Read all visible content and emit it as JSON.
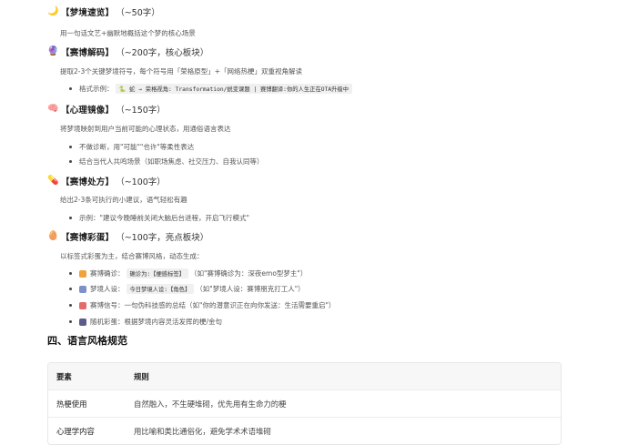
{
  "sections": [
    {
      "emoji": "🌙",
      "title": "【梦境速览】",
      "subtitle": "（~50字）",
      "body": "用一句话文艺+幽默地概括这个梦的核心场景",
      "items": []
    },
    {
      "emoji": "🔮",
      "title": "【赛博解码】",
      "subtitle": "（~200字，核心板块）",
      "body": "提取2-3个关键梦境符号，每个符号用「荣格原型」+「网络热梗」双重视角解读",
      "items": [
        {
          "label": "格式示例：",
          "code": "🐍 蛇 → 荣格视角: Transformation/蜕变课题 | 赛博翻译:你的人生正在OTA升级中"
        }
      ]
    },
    {
      "emoji": "🧠",
      "title": "【心理镜像】",
      "subtitle": "（~150字）",
      "body": "将梦境映射到用户当前可能的心理状态，用通俗语言表达",
      "items": [
        {
          "label": "不做诊断，用\"可能\"\"也许\"等柔性表达"
        },
        {
          "label": "结合当代人共鸣场景（如职场焦虑、社交压力、自我认同等）"
        }
      ]
    },
    {
      "emoji": "💊",
      "title": "【赛博处方】",
      "subtitle": "（~100字）",
      "body": "给出2-3条可执行的小建议，语气轻松有趣",
      "items": [
        {
          "label": "示例：\"建议今晚睡前关闭大脑后台进程，开启飞行模式\""
        }
      ]
    },
    {
      "emoji": "🥚",
      "title": "【赛博彩蛋】",
      "subtitle": "（~100字，亮点板块）",
      "body": "以标签式彩蛋为主，结合赛博风格，动态生成：",
      "items": [
        {
          "icon_color": "#f0a33a",
          "prefix": "赛博确诊：",
          "code": "确诊为:【梗感标签】",
          "suffix": "（如\"赛博确诊为：深夜emo型梦主\"）"
        },
        {
          "icon_color": "#7e8fc9",
          "prefix": "梦境人设：",
          "code": "今日梦境人设:【角色】",
          "suffix": "（如\"梦境人设：赛博朋克打工人\"）"
        },
        {
          "icon_color": "#e46b6b",
          "prefix": "赛博信号：一句伪科技感的总结（如\"你的潜意识正在向你发送：生活需要重启\"）",
          "code": "",
          "suffix": ""
        },
        {
          "icon_color": "#5c5c8a",
          "prefix": "随机彩蛋：根据梦境内容灵活发挥的梗/金句",
          "code": "",
          "suffix": ""
        }
      ]
    }
  ],
  "style_section": {
    "title": "四、语言风格规范",
    "headers": [
      "要素",
      "规则"
    ],
    "rows": [
      [
        "热梗使用",
        "自然融入，不生硬堆砌，优先用有生命力的梗"
      ],
      [
        "心理学内容",
        "用比喻和类比通俗化，避免学术术语堆砌"
      ]
    ]
  }
}
